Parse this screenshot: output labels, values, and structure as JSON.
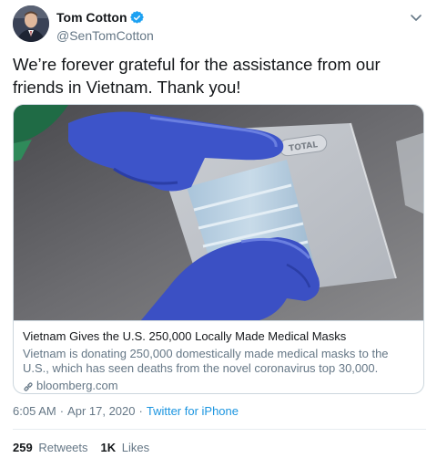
{
  "author": {
    "display_name": "Tom Cotton",
    "handle": "@SenTomCotton",
    "verified": true,
    "verified_color": "#1da1f2"
  },
  "tweet": {
    "text": "We’re forever grateful for the assistance from our friends in Vietnam. Thank you!"
  },
  "card": {
    "image_icon": "photo-of-gloved-hands-holding-medical-masks",
    "image_text": "TOTAL",
    "title": "Vietnam Gives the U.S. 250,000 Locally Made Medical Masks",
    "description": "Vietnam is donating 250,000 domestically made medical masks to the U.S., which has seen deaths from the novel coronavirus top 30,000.",
    "domain": "bloomberg.com",
    "domain_icon": "link-icon"
  },
  "meta": {
    "time": "6:05 AM",
    "separator": "·",
    "date": "Apr 17, 2020",
    "source": "Twitter for iPhone"
  },
  "stats": {
    "retweets_count": "259",
    "retweets_label": "Retweets",
    "likes_count": "1K",
    "likes_label": "Likes"
  },
  "colors": {
    "link_blue": "#1b95e0",
    "secondary_text": "#657786",
    "border": "#ccd6dd"
  },
  "icons": {
    "caret": "chevron-down-icon",
    "verified": "verified-badge-icon"
  }
}
